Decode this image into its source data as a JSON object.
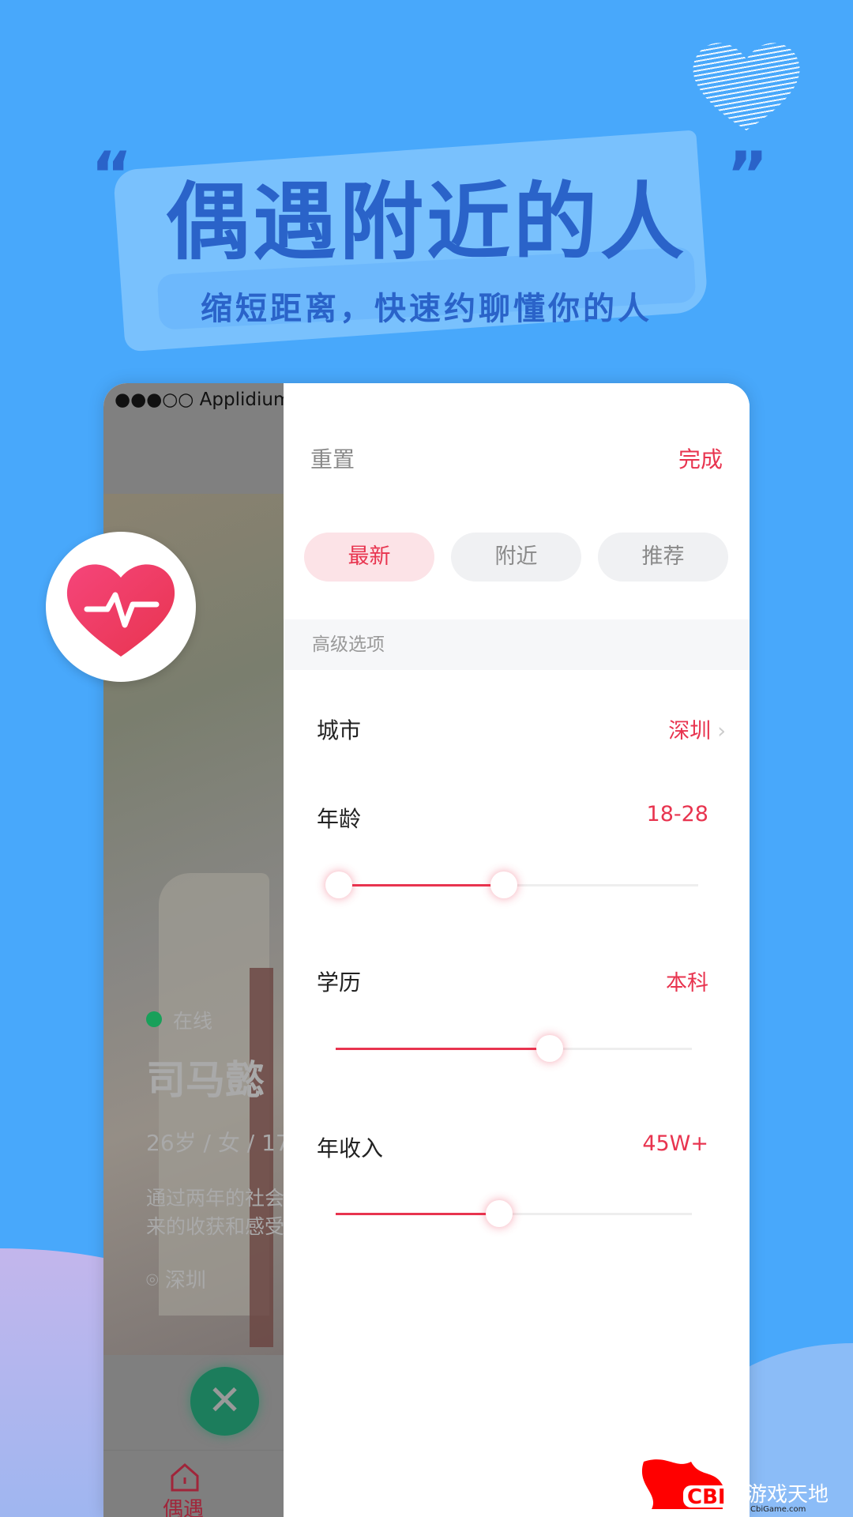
{
  "promo": {
    "title": "偶遇附近的人",
    "subtitle": "缩短距离，快速约聊懂你的人",
    "quote_open": "“",
    "quote_close": "”"
  },
  "status_bar": {
    "signal": "●●●○○",
    "carrier": "Applidium"
  },
  "profile": {
    "status": "在线",
    "name": "司马懿",
    "info": "26岁 / 女 / 17",
    "desc_line1": "通过两年的社会",
    "desc_line2": "来的收获和感受",
    "location": "深圳"
  },
  "bottom_tab": {
    "label": "偶遇"
  },
  "filter": {
    "reset": "重置",
    "done": "完成",
    "sort_options": [
      {
        "label": "最新",
        "active": true
      },
      {
        "label": "附近",
        "active": false
      },
      {
        "label": "推荐",
        "active": false
      }
    ],
    "advanced_header": "高级选项",
    "city": {
      "label": "城市",
      "value": "深圳"
    },
    "age": {
      "label": "年龄",
      "value": "18-28",
      "range_fraction": [
        0,
        0.46
      ]
    },
    "education": {
      "label": "学历",
      "value": "本科",
      "fraction": 0.6
    },
    "income": {
      "label": "年收入",
      "value": "45W+",
      "fraction": 0.46
    }
  },
  "watermark": {
    "text": "CBI 游戏天地",
    "url_text": "CbiGame.com"
  },
  "colors": {
    "background": "#48a8fb",
    "accent": "#e8344f",
    "title": "#2a63c9"
  }
}
